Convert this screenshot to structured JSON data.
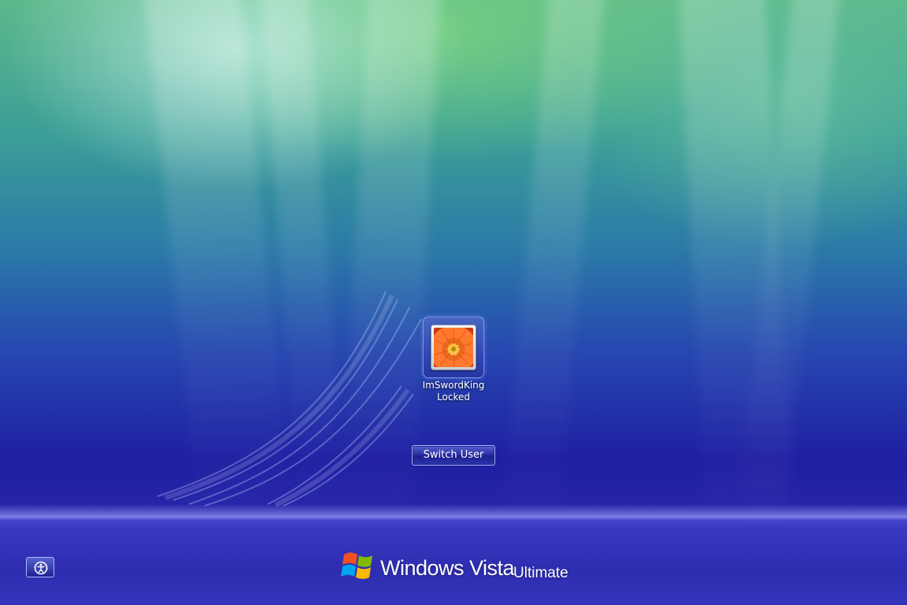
{
  "lock_screen": {
    "user": {
      "name": "ImSwordKing",
      "status": "Locked",
      "picture": "orange-gerbera-flower"
    },
    "switch_user_label": "Switch User",
    "ease_of_access_icon": "ease-of-access-icon"
  },
  "branding": {
    "windows_vista": "Windows Vista",
    "edition": "Ultimate",
    "logo_icon": "windows-flag-icon"
  },
  "colors": {
    "background_top": "#5cb88a",
    "background_bottom": "#2725a8",
    "button_border": "#9fb2ff",
    "text": "#ffffff"
  }
}
